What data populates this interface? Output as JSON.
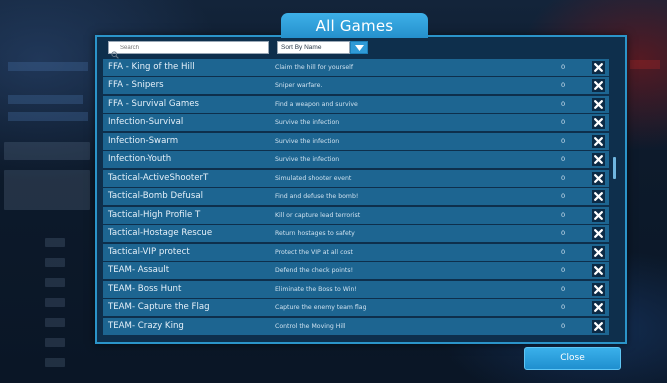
{
  "dialog": {
    "title": "All Games",
    "search_placeholder": "Search",
    "sort_label": "Sort By Name",
    "close_label": "Close"
  },
  "rows": [
    {
      "name": "FFA - King of the Hill",
      "desc": "Claim the hill for yourself",
      "count": "0"
    },
    {
      "name": "FFA - Snipers",
      "desc": "Sniper warfare.",
      "count": "0"
    },
    {
      "name": "FFA - Survival Games",
      "desc": "Find a weapon and survive",
      "count": "0"
    },
    {
      "name": "Infection-Survival",
      "desc": "Survive the infection",
      "count": "0"
    },
    {
      "name": "Infection-Swarm",
      "desc": "Survive the infection",
      "count": "0"
    },
    {
      "name": "Infection-Youth",
      "desc": "Survive the infection",
      "count": "0"
    },
    {
      "name": "Tactical-ActiveShooterT",
      "desc": "Simulated shooter event",
      "count": "0"
    },
    {
      "name": "Tactical-Bomb Defusal",
      "desc": "Find and defuse the bomb!",
      "count": "0"
    },
    {
      "name": "Tactical-High Profile T",
      "desc": "Kill or capture lead terrorist",
      "count": "0"
    },
    {
      "name": "Tactical-Hostage Rescue",
      "desc": "Return hostages to safety",
      "count": "0"
    },
    {
      "name": "Tactical-VIP protect",
      "desc": "Protect the VIP at all cost",
      "count": "0"
    },
    {
      "name": "TEAM- Assault",
      "desc": "Defend the check points!",
      "count": "0"
    },
    {
      "name": "TEAM- Boss Hunt",
      "desc": "Eliminate the Boss to Win!",
      "count": "0"
    },
    {
      "name": "TEAM- Capture the Flag",
      "desc": "Capture the enemy team flag",
      "count": "0"
    },
    {
      "name": "TEAM- Crazy King",
      "desc": "Control the Moving Hill",
      "count": "0"
    }
  ],
  "icons": {
    "search": "search-icon",
    "sort_dropdown": "chevron-down-icon",
    "delete": "close-icon"
  },
  "colors": {
    "accent": "#2f9ad6",
    "row": "#1d6591",
    "dialog_bg": "#0e2f4c",
    "delete_bg": "#0c2a45"
  }
}
